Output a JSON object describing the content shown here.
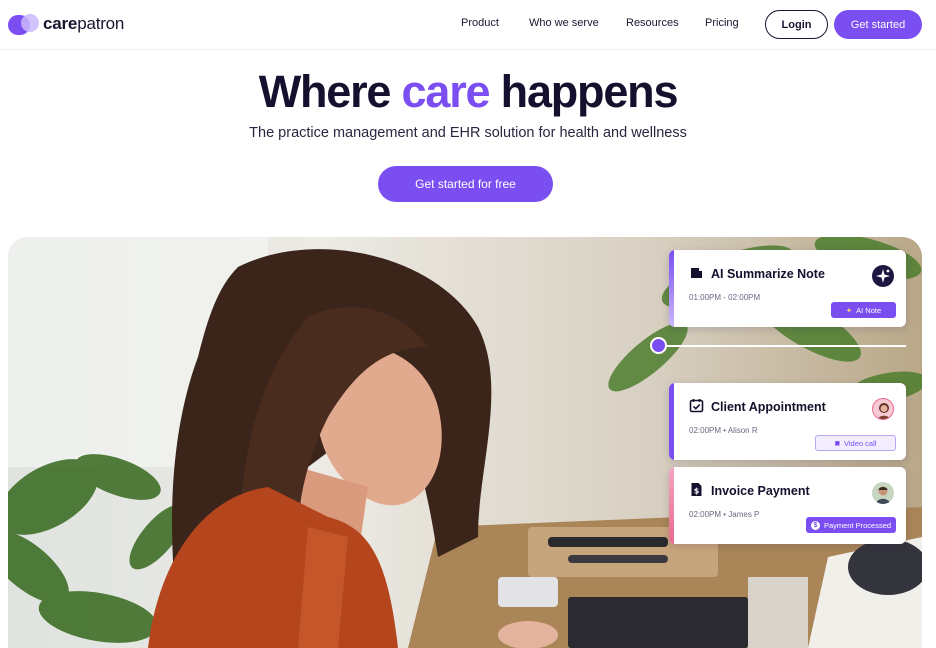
{
  "brand": {
    "care": "care",
    "patron": "patron",
    "color": "#7b4ef2"
  },
  "nav": {
    "links": [
      "Product",
      "Who we serve",
      "Resources",
      "Pricing"
    ],
    "login": "Login",
    "get_started": "Get started"
  },
  "hero": {
    "title_part1": "Where",
    "title_accent": "care",
    "title_part2": "happens",
    "subtitle": "The practice management and EHR solution for health and wellness",
    "cta": "Get started for free"
  },
  "cards": {
    "ai_note": {
      "title": "AI Summarize Note",
      "time": "01:00PM - 02:00PM",
      "pill": "AI Note",
      "icon": "note-icon"
    },
    "appointment": {
      "title": "Client Appointment",
      "time": "02:00PM • Alison R",
      "pill": "Video call",
      "icon": "calendar-check-icon"
    },
    "invoice": {
      "title": "Invoice Payment",
      "time": "02:00PM • James P",
      "pill": "Payment Processed",
      "icon": "invoice-icon"
    }
  },
  "colors": {
    "accent": "#7b4ef2",
    "text": "#15102e"
  }
}
